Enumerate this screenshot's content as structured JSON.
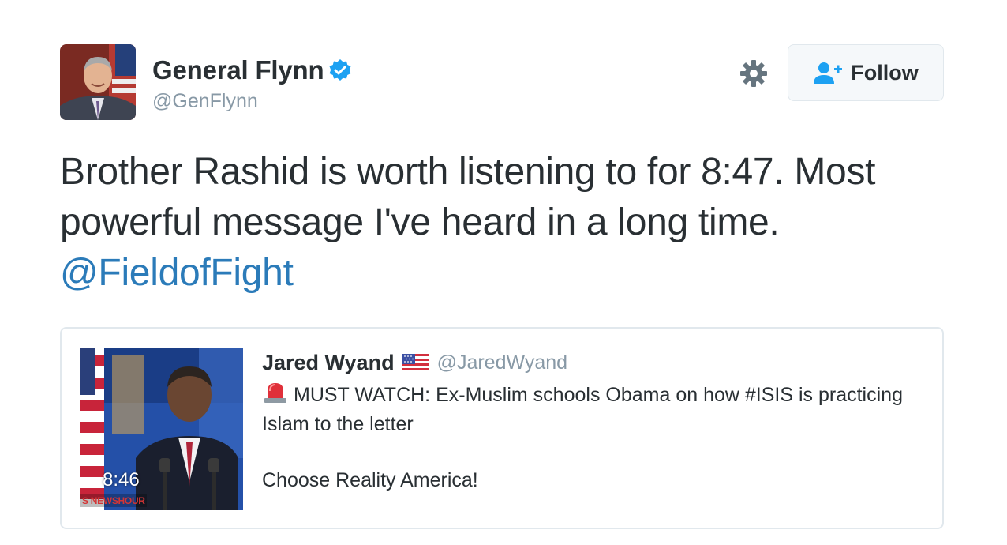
{
  "author": {
    "display_name": "General Flynn",
    "handle": "@GenFlynn",
    "verified": true
  },
  "actions": {
    "settings_icon": "gear-icon",
    "follow_label": "Follow",
    "follow_icon": "add-user-icon"
  },
  "tweet": {
    "text": "Brother Rashid is worth listening to for 8:47. Most powerful message I've heard in a long time.",
    "mention": "@FieldofFight"
  },
  "quoted": {
    "display_name": "Jared Wyand",
    "handle": "@JaredWyand",
    "flag_emoji": "us-flag-icon",
    "siren_emoji": "siren-icon",
    "text": "MUST WATCH: Ex-Muslim schools Obama on how #ISIS is practicing Islam to the letter",
    "text2": "Choose Reality America!",
    "video_duration": "8:46",
    "video_logo": "S NEWSHOUR"
  },
  "colors": {
    "link": "#2b7bb9",
    "text": "#292f33",
    "muted": "#8899a6",
    "verified": "#1da1f2",
    "border": "#e1e8ed"
  }
}
